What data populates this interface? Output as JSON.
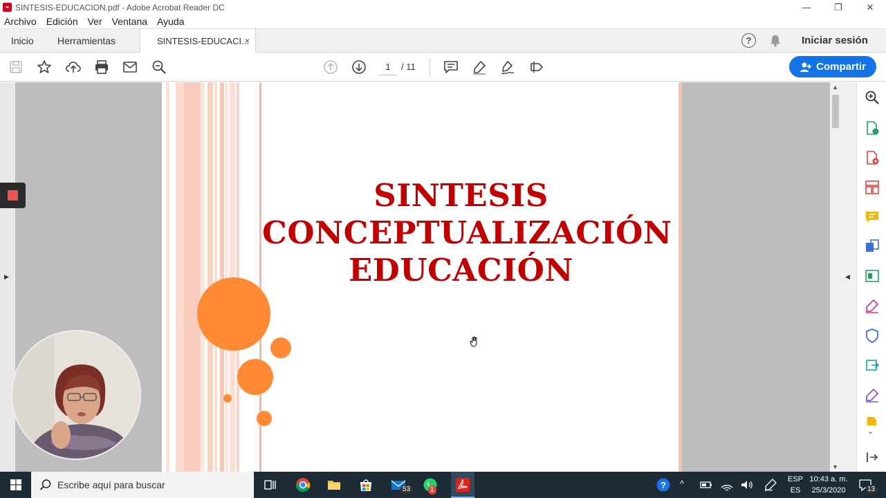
{
  "window": {
    "title": "SINTESIS-EDUCACION.pdf - Adobe Acrobat Reader DC",
    "controls": [
      "—",
      "❐",
      "✕"
    ]
  },
  "menu": [
    "Archivo",
    "Edición",
    "Ver",
    "Ventana",
    "Ayuda"
  ],
  "tabs": {
    "home": "Inicio",
    "tools": "Herramientas",
    "document": "SINTESIS-EDUCACI...",
    "close": "×"
  },
  "header": {
    "signin": "Iniciar sesión",
    "help": "?"
  },
  "toolbar": {
    "page_current": "1",
    "page_total": "/ 11",
    "share_label": "Compartir"
  },
  "slide": {
    "title_lines": [
      "SINTESIS",
      "CONCEPTUALIZACIÓN",
      "EDUCACIÓN"
    ]
  },
  "taskbar": {
    "search_placeholder": "Escribe aquí para buscar",
    "mail_badge": "53",
    "whatsapp_badge": "1",
    "lang_top": "ESP",
    "lang_bottom": "ES",
    "time": "10:43 a. m.",
    "date": "25/3/2020",
    "notifications": "13"
  },
  "colors": {
    "accent": "#1473e6",
    "title_red": "#c00000",
    "circle_orange": "#ff8a33",
    "taskbar": "#1c2b36"
  }
}
